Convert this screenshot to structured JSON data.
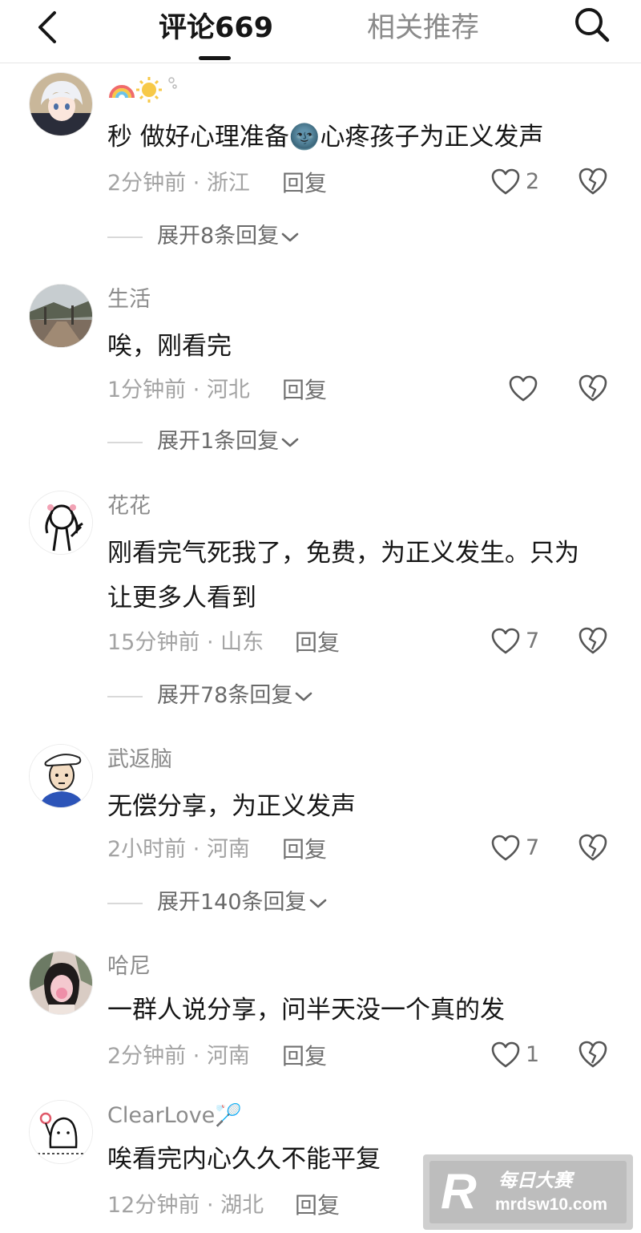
{
  "header": {
    "tab_comments": "评论669",
    "tab_related": "相关推荐"
  },
  "comments": [
    {
      "username": "",
      "text": "秒 做好心理准备🌚心疼孩子为正义发声",
      "time": "2分钟前",
      "location": "浙江",
      "reply": "回复",
      "likes": "2",
      "expand": "展开8条回复",
      "emoji_name": "rainbow-sun-emoji"
    },
    {
      "username": "生活",
      "text": "唉，刚看完",
      "time": "1分钟前",
      "location": "河北",
      "reply": "回复",
      "likes": "",
      "expand": "展开1条回复"
    },
    {
      "username": "花花",
      "text": "刚看完气死我了，免费，为正义发生。只为让更多人看到",
      "time": "15分钟前",
      "location": "山东",
      "reply": "回复",
      "likes": "7",
      "expand": "展开78条回复"
    },
    {
      "username": "武返脑",
      "text": "无偿分享，为正义发声",
      "time": "2小时前",
      "location": "河南",
      "reply": "回复",
      "likes": "7",
      "expand": "展开140条回复"
    },
    {
      "username": "哈尼",
      "text": "一群人说分享，问半天没一个真的发",
      "time": "2分钟前",
      "location": "河南",
      "reply": "回复",
      "likes": "1",
      "expand": ""
    },
    {
      "username": "ClearLove🏸",
      "text": "唉看完内心久久不能平复",
      "time": "12分钟前",
      "location": "湖北",
      "reply": "回复",
      "likes": "",
      "expand": ""
    }
  ],
  "meta_separator": " · ",
  "watermark": {
    "logo": "R",
    "name": "每日大赛",
    "url": "mrdsw10.com"
  },
  "colors": {
    "text_primary": "#161616",
    "text_secondary": "#8c8c8c",
    "divider": "#e6e6e6"
  },
  "icons": [
    "back-arrow-icon",
    "search-icon",
    "heart-icon",
    "broken-heart-icon",
    "chevron-down-icon"
  ]
}
